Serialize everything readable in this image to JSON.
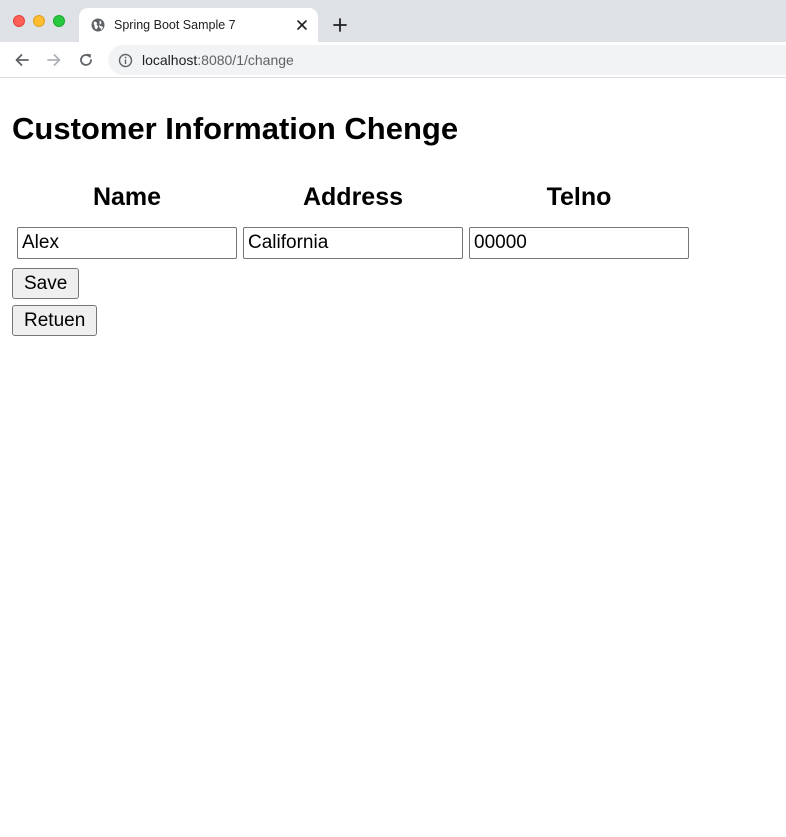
{
  "browser": {
    "tab_title": "Spring Boot Sample 7",
    "url_host": "localhost",
    "url_path": ":8080/1/change"
  },
  "page": {
    "title": "Customer Information Chenge",
    "columns": [
      "Name",
      "Address",
      "Telno"
    ],
    "fields": {
      "name": "Alex",
      "address": "California",
      "telno": "00000"
    },
    "save_label": "Save",
    "return_label": "Retuen"
  }
}
